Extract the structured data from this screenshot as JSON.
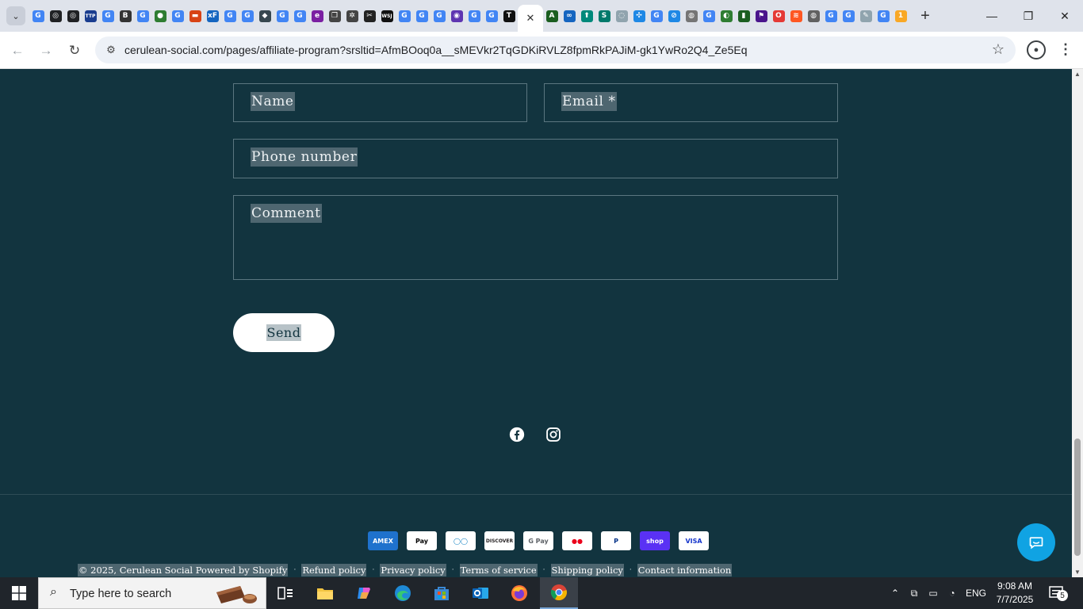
{
  "browser": {
    "url_host": "cerulean-social.com",
    "url_rest": "/pages/affiliate-program?srsltid=AfmBOoq0a__sMEVkr2TqGDKiRVLZ8fpmRkPAJiM-gk1YwRo2Q4_Ze5Eq",
    "tabs": [
      {
        "icon": "google-icon",
        "glyph": "G",
        "color": "#4285f4"
      },
      {
        "icon": "openai-icon",
        "glyph": "◎",
        "color": "#202124"
      },
      {
        "icon": "openai-icon",
        "glyph": "◎",
        "color": "#202124"
      },
      {
        "icon": "ttp-icon",
        "glyph": "TTP",
        "color": "#1a3d8f"
      },
      {
        "icon": "google-icon",
        "glyph": "G",
        "color": "#4285f4"
      },
      {
        "icon": "b-icon",
        "glyph": "B",
        "color": "#333333"
      },
      {
        "icon": "google-icon",
        "glyph": "G",
        "color": "#4285f4"
      },
      {
        "icon": "globe-green-icon",
        "glyph": "●",
        "color": "#2e7d32"
      },
      {
        "icon": "google-icon",
        "glyph": "G",
        "color": "#4285f4"
      },
      {
        "icon": "burger-icon",
        "glyph": "▬",
        "color": "#d84315"
      },
      {
        "icon": "xf-icon",
        "glyph": "xF",
        "color": "#1565c0"
      },
      {
        "icon": "google-icon",
        "glyph": "G",
        "color": "#4285f4"
      },
      {
        "icon": "google-icon",
        "glyph": "G",
        "color": "#4285f4"
      },
      {
        "icon": "layers-icon",
        "glyph": "◆",
        "color": "#37474f"
      },
      {
        "icon": "google-icon",
        "glyph": "G",
        "color": "#4285f4"
      },
      {
        "icon": "google-icon",
        "glyph": "G",
        "color": "#4285f4"
      },
      {
        "icon": "e-icon",
        "glyph": "e",
        "color": "#7b1fa2"
      },
      {
        "icon": "copy-icon",
        "glyph": "❐",
        "color": "#444444"
      },
      {
        "icon": "gear-icon",
        "glyph": "✲",
        "color": "#444444"
      },
      {
        "icon": "tools-icon",
        "glyph": "✂",
        "color": "#222222"
      },
      {
        "icon": "wsj-icon",
        "glyph": "WSJ",
        "color": "#111111"
      },
      {
        "icon": "google-icon",
        "glyph": "G",
        "color": "#4285f4"
      },
      {
        "icon": "google-icon",
        "glyph": "G",
        "color": "#4285f4"
      },
      {
        "icon": "google-icon",
        "glyph": "G",
        "color": "#4285f4"
      },
      {
        "icon": "circle-purple-icon",
        "glyph": "◉",
        "color": "#5e35b1"
      },
      {
        "icon": "google-icon",
        "glyph": "G",
        "color": "#4285f4"
      },
      {
        "icon": "google-icon",
        "glyph": "G",
        "color": "#4285f4"
      },
      {
        "icon": "t-icon",
        "glyph": "T",
        "color": "#111111"
      }
    ],
    "tabs_after": [
      {
        "icon": "a-icon",
        "glyph": "A",
        "color": "#1b5e20"
      },
      {
        "icon": "link-icon",
        "glyph": "∞",
        "color": "#1565c0"
      },
      {
        "icon": "up-arrow-icon",
        "glyph": "⬆",
        "color": "#00897b"
      },
      {
        "icon": "s-icon",
        "glyph": "S",
        "color": "#00796b"
      },
      {
        "icon": "ring-icon",
        "glyph": "◌",
        "color": "#90a4ae"
      },
      {
        "icon": "dots-icon",
        "glyph": "✣",
        "color": "#1e88e5"
      },
      {
        "icon": "google-icon",
        "glyph": "G",
        "color": "#4285f4"
      },
      {
        "icon": "slash-icon",
        "glyph": "⊘",
        "color": "#1e88e5"
      },
      {
        "icon": "globe-icon",
        "glyph": "◍",
        "color": "#757575"
      },
      {
        "icon": "google-icon",
        "glyph": "G",
        "color": "#4285f4"
      },
      {
        "icon": "leaf-icon",
        "glyph": "◐",
        "color": "#2e7d32"
      },
      {
        "icon": "bars-icon",
        "glyph": "▮",
        "color": "#1b5e20"
      },
      {
        "icon": "flag-icon",
        "glyph": "⚑",
        "color": "#4a148c"
      },
      {
        "icon": "opera-icon",
        "glyph": "O",
        "color": "#e53935"
      },
      {
        "icon": "flow-icon",
        "glyph": "≋",
        "color": "#ff5722"
      },
      {
        "icon": "globe-icon",
        "glyph": "◍",
        "color": "#616161"
      },
      {
        "icon": "google-icon",
        "glyph": "G",
        "color": "#4285f4"
      },
      {
        "icon": "google-icon",
        "glyph": "G",
        "color": "#4285f4"
      },
      {
        "icon": "pen-icon",
        "glyph": "✎",
        "color": "#90a4ae"
      },
      {
        "icon": "google-icon",
        "glyph": "G",
        "color": "#4285f4"
      },
      {
        "icon": "one-icon",
        "glyph": "1",
        "color": "#f9a825"
      }
    ]
  },
  "form": {
    "name_placeholder": "Name",
    "email_placeholder": "Email *",
    "phone_placeholder": "Phone number",
    "comment_placeholder": "Comment",
    "send_label": "Send"
  },
  "footer": {
    "social": [
      "facebook-icon",
      "instagram-icon"
    ],
    "payments": [
      {
        "name": "American Express",
        "label": "AMEX",
        "bg": "#1f72cd",
        "fg": "#ffffff"
      },
      {
        "name": "Apple Pay",
        "label": "Pay",
        "bg": "#ffffff",
        "fg": "#000000"
      },
      {
        "name": "Diners Club",
        "label": "◯◯",
        "bg": "#ffffff",
        "fg": "#0079be"
      },
      {
        "name": "Discover",
        "label": "DISCOVER",
        "bg": "#ffffff",
        "fg": "#231f20"
      },
      {
        "name": "Google Pay",
        "label": "G Pay",
        "bg": "#ffffff",
        "fg": "#5f6368"
      },
      {
        "name": "Mastercard",
        "label": "●●",
        "bg": "#ffffff",
        "fg": "#eb001b"
      },
      {
        "name": "PayPal",
        "label": "P",
        "bg": "#ffffff",
        "fg": "#003087"
      },
      {
        "name": "Shop Pay",
        "label": "shop",
        "bg": "#5a31f4",
        "fg": "#ffffff"
      },
      {
        "name": "Visa",
        "label": "VISA",
        "bg": "#ffffff",
        "fg": "#1434cb"
      }
    ],
    "copyright": "© 2025, Cerulean Social Powered by Shopify",
    "links": [
      "Refund policy",
      "Privacy policy",
      "Terms of service",
      "Shipping policy",
      "Contact information"
    ]
  },
  "taskbar": {
    "search_placeholder": "Type here to search",
    "language": "ENG",
    "time": "9:08 AM",
    "date": "7/7/2025",
    "notification_count": "5"
  }
}
